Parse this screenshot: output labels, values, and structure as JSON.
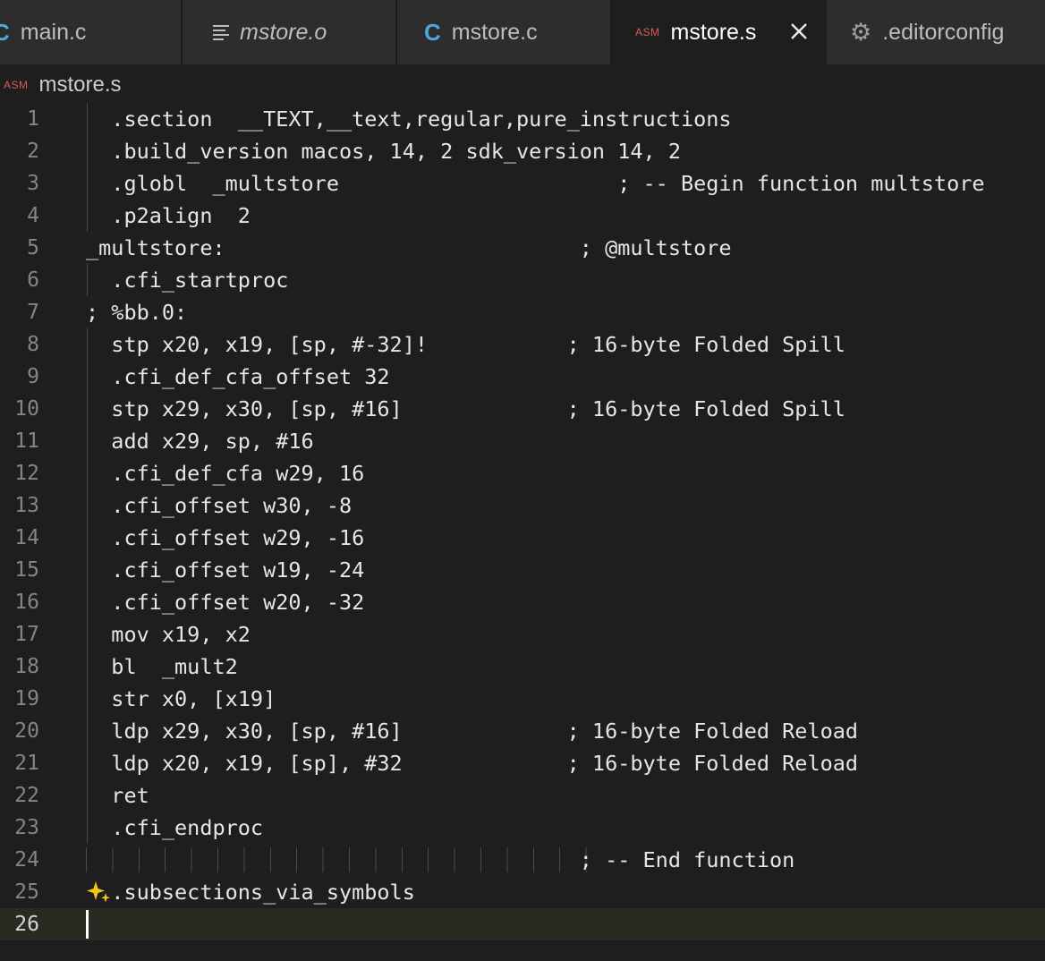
{
  "tabs": [
    {
      "label": "main.c",
      "icon": "c-file-icon",
      "active": false
    },
    {
      "label": "mstore.o",
      "icon": "text-lines-icon",
      "active": false
    },
    {
      "label": "mstore.c",
      "icon": "c-file-icon",
      "active": false
    },
    {
      "label": "mstore.s",
      "icon": "asm-file-icon",
      "active": true
    },
    {
      "label": ".editorconfig",
      "icon": "gear-icon",
      "active": false
    }
  ],
  "icons": {
    "c": "C",
    "asm": "ASM"
  },
  "breadcrumb": {
    "file": "mstore.s"
  },
  "colors": {
    "background": "#1e1e1e",
    "tab_background": "#2d2d2d",
    "c_icon": "#4fa6dd",
    "asm_icon": "#d75c5c",
    "line_number": "#858585",
    "code_text": "#e6e6e6",
    "current_line": "#2a2a22",
    "sparkle": "#f5c518"
  },
  "editor": {
    "current_line": 26,
    "lines": [
      {
        "n": "1",
        "text": "  .section  __TEXT,__text,regular,pure_instructions"
      },
      {
        "n": "2",
        "text": "  .build_version macos, 14, 2 sdk_version 14, 2"
      },
      {
        "n": "3",
        "text": "  .globl  _multstore                      ; -- Begin function multstore"
      },
      {
        "n": "4",
        "text": "  .p2align  2"
      },
      {
        "n": "5",
        "text": "_multstore:                            ; @multstore"
      },
      {
        "n": "6",
        "text": "  .cfi_startproc"
      },
      {
        "n": "7",
        "text": "; %bb.0:"
      },
      {
        "n": "8",
        "text": "  stp x20, x19, [sp, #-32]!           ; 16-byte Folded Spill"
      },
      {
        "n": "9",
        "text": "  .cfi_def_cfa_offset 32"
      },
      {
        "n": "10",
        "text": "  stp x29, x30, [sp, #16]             ; 16-byte Folded Spill"
      },
      {
        "n": "11",
        "text": "  add x29, sp, #16"
      },
      {
        "n": "12",
        "text": "  .cfi_def_cfa w29, 16"
      },
      {
        "n": "13",
        "text": "  .cfi_offset w30, -8"
      },
      {
        "n": "14",
        "text": "  .cfi_offset w29, -16"
      },
      {
        "n": "15",
        "text": "  .cfi_offset w19, -24"
      },
      {
        "n": "16",
        "text": "  .cfi_offset w20, -32"
      },
      {
        "n": "17",
        "text": "  mov x19, x2"
      },
      {
        "n": "18",
        "text": "  bl  _mult2"
      },
      {
        "n": "19",
        "text": "  str x0, [x19]"
      },
      {
        "n": "20",
        "text": "  ldp x29, x30, [sp, #16]             ; 16-byte Folded Reload"
      },
      {
        "n": "21",
        "text": "  ldp x20, x19, [sp], #32             ; 16-byte Folded Reload"
      },
      {
        "n": "22",
        "text": "  ret"
      },
      {
        "n": "23",
        "text": "  .cfi_endproc"
      },
      {
        "n": "24",
        "text": "                                       ; -- End function"
      },
      {
        "n": "25",
        "text": "  .subsections_via_symbols"
      },
      {
        "n": "26",
        "text": ""
      }
    ]
  }
}
